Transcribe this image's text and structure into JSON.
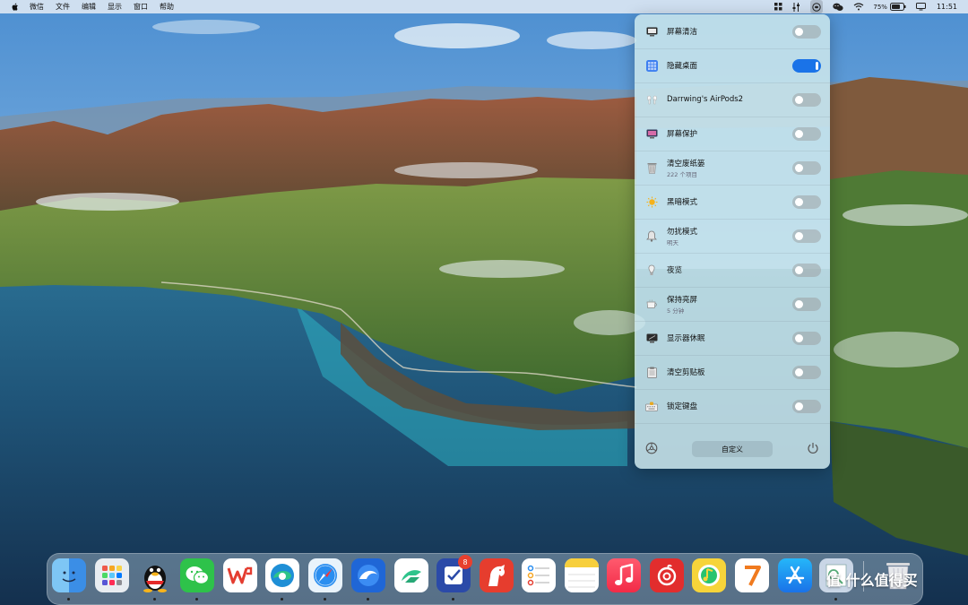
{
  "menubar": {
    "items": [
      "微信",
      "文件",
      "编辑",
      "显示",
      "窗口",
      "帮助"
    ],
    "battery_percent": "75%",
    "clock": "11:51"
  },
  "panel": {
    "rows": [
      {
        "title": "屏幕清洁",
        "icon": "monitor-clean-icon",
        "enabled": false
      },
      {
        "title": "隐藏桌面",
        "icon": "hide-desktop-icon",
        "enabled": true
      },
      {
        "title": "Darrwing's AirPods2",
        "icon": "airpods-icon",
        "enabled": false
      },
      {
        "title": "屏幕保护",
        "icon": "screensaver-icon",
        "enabled": false
      },
      {
        "title": "清空废纸篓",
        "subtitle": "222 个项目",
        "icon": "trash-icon",
        "enabled": false
      },
      {
        "title": "黑暗模式",
        "icon": "sun-icon",
        "enabled": false
      },
      {
        "title": "勿扰模式",
        "subtitle": "明天",
        "icon": "bell-icon",
        "enabled": false
      },
      {
        "title": "夜览",
        "icon": "nightshift-icon",
        "enabled": false
      },
      {
        "title": "保持亮屏",
        "subtitle": "5 分钟",
        "icon": "coffee-icon",
        "enabled": false
      },
      {
        "title": "显示器休眠",
        "icon": "display-sleep-icon",
        "enabled": false
      },
      {
        "title": "清空剪贴板",
        "icon": "clipboard-icon",
        "enabled": false
      },
      {
        "title": "锁定键盘",
        "icon": "keyboard-lock-icon",
        "enabled": false
      }
    ],
    "customize_label": "自定义"
  },
  "dock": {
    "apps": [
      "Finder",
      "Launchpad",
      "QQ",
      "WeChat",
      "WPS",
      "Edge",
      "Safari",
      "Browser",
      "Feishu",
      "OmniFocus",
      "Paw",
      "Reminders",
      "Notes",
      "Music",
      "NetEase Music",
      "QQ Music",
      "App7",
      "App Store",
      "Preview",
      "Trash"
    ],
    "badge_count": "8"
  },
  "watermark": "值 什么值得买",
  "colors": {
    "toggle_on": "#1a73e8",
    "panel_bg": "#cde8ec",
    "menubar_bg": "#ebf0f6"
  }
}
